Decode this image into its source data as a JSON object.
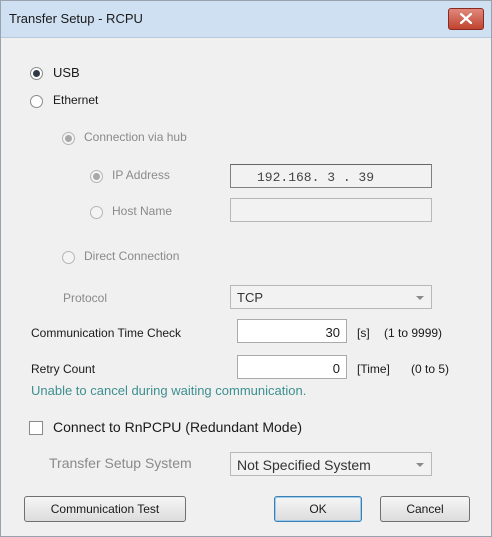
{
  "window": {
    "title": "Transfer Setup - RCPU"
  },
  "connection": {
    "usb_label": "USB",
    "ethernet_label": "Ethernet",
    "via_hub_label": "Connection via hub",
    "ip_label": "IP Address",
    "ip_value": "192.168. 3 . 39",
    "host_label": "Host Name",
    "host_value": "",
    "direct_label": "Direct Connection",
    "protocol_label": "Protocol",
    "protocol_value": "TCP"
  },
  "timing": {
    "comm_time_label": "Communication Time Check",
    "comm_time_value": "30",
    "comm_time_unit": "[s]",
    "comm_time_range": "(1 to 9999)",
    "retry_label": "Retry Count",
    "retry_value": "0",
    "retry_unit": "[Time]",
    "retry_range": "(0 to 5)",
    "info_text": "Unable to cancel during waiting communication."
  },
  "redundant": {
    "checkbox_label": "Connect to RnPCPU (Redundant Mode)",
    "system_label": "Transfer Setup System",
    "system_value": "Not Specified System"
  },
  "buttons": {
    "test_label": "Communication Test",
    "ok_label": "OK",
    "cancel_label": "Cancel"
  },
  "colors": {
    "titlebar": "#cfe0f2",
    "close": "#c0432f",
    "info_text": "#3e8f8f",
    "dialog_bg": "#f0f0f0"
  },
  "icons": [
    "close-icon",
    "dropdown-arrow-icon"
  ]
}
